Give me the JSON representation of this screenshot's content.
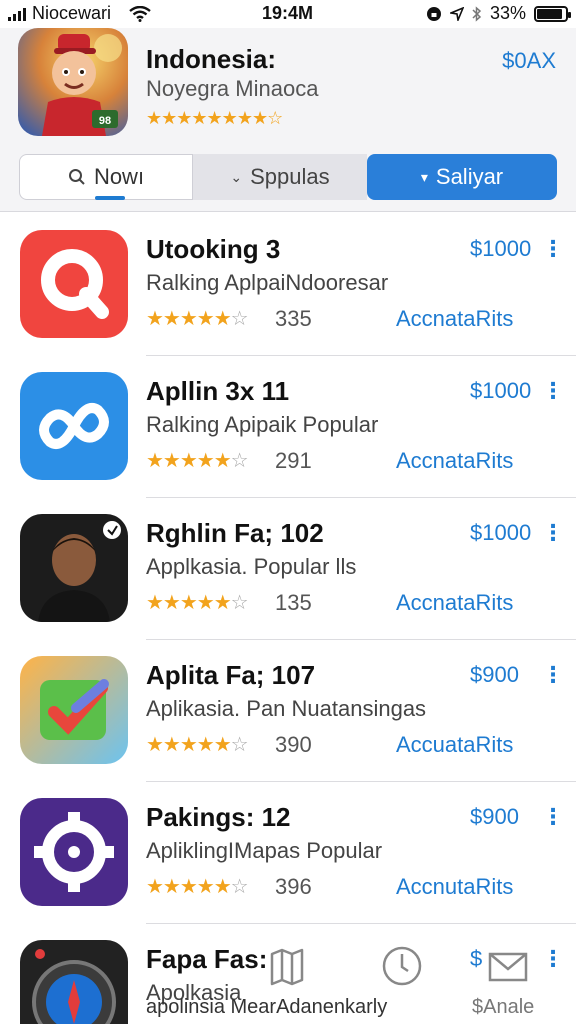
{
  "status": {
    "carrier": "Niocewari",
    "time": "19:4M",
    "battery": "33%",
    "battery_level": 0.9
  },
  "hero": {
    "title": "Indonesia:",
    "subtitle": "Noyegra Minaoca",
    "stars": "★★★★★★★★☆",
    "price": "$0AX",
    "icon": "cartoon-character-icon"
  },
  "tabs": [
    {
      "label": "Nowı",
      "icon": "search-icon"
    },
    {
      "label": "Sppulas",
      "icon": "chevron-down-icon"
    },
    {
      "label": "Saliyar",
      "icon": "chevron-down-icon",
      "selected": true
    }
  ],
  "apps": [
    {
      "name": "Utooking 3",
      "subtitle": "Ralking AplpaiNdooresar",
      "stars": "★★★★★",
      "empty": "☆",
      "count": "335",
      "price": "$1000",
      "action": "AccnataRits",
      "more": "⋮",
      "icon": "magnifier-app-icon",
      "color": "#f0453f"
    },
    {
      "name": "Apllin 3x 11",
      "subtitle": "Ralking Apipaik Popular",
      "stars": "★★★★★",
      "empty": "☆",
      "count": "291",
      "price": "$1000",
      "action": "AccnataRits",
      "more": "⋮",
      "icon": "infinity-app-icon",
      "color": "#2c8fe6"
    },
    {
      "name": "Rghlin Fa; 102",
      "subtitle": "Applkasia. Popular lls",
      "stars": "★★★★★",
      "empty": "☆",
      "count": "135",
      "price": "$1000",
      "action": "AccnataRits",
      "more": "⋮",
      "icon": "portrait-app-icon",
      "color": "#1c1c1c"
    },
    {
      "name": "Aplita Fa; 107",
      "subtitle": "Aplikasia. Pan Nuatansingas",
      "stars": "★★★★★",
      "empty": "☆",
      "count": "390",
      "price": "$900",
      "action": "AccuataRits",
      "more": "⋮",
      "icon": "checkmark-app-icon",
      "color": "#5bbf4a"
    },
    {
      "name": "Pakings: 12",
      "subtitle": "ApliklingIMapas Popular",
      "stars": "★★★★★",
      "empty": "☆",
      "count": "396",
      "price": "$900",
      "action": "AccnutaRits",
      "more": "⋮",
      "icon": "gear-app-icon",
      "color": "#4b2a8a"
    },
    {
      "name": "Fapa Fas:",
      "subtitle": "Apolkasia",
      "stars": "",
      "empty": "",
      "count": "",
      "price": "$",
      "action": "",
      "more": "⋮",
      "icon": "compass-app-icon",
      "color": "#222222"
    }
  ],
  "bottom": {
    "text": "apolinsia MearAdanenkarly",
    "right_label": "$Anale",
    "icons": [
      "map-icon",
      "clock-icon",
      "mail-icon"
    ]
  }
}
